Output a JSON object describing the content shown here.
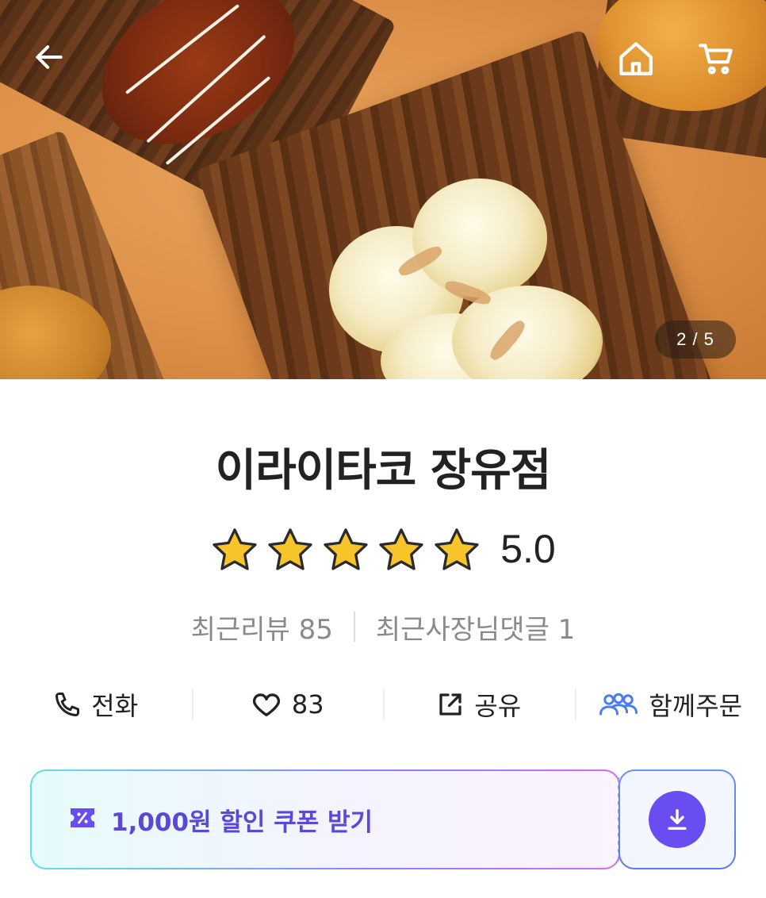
{
  "hero": {
    "image_counter": "2 / 5",
    "icons": {
      "back": "arrow-left-icon",
      "home": "home-icon",
      "cart": "cart-icon"
    }
  },
  "store": {
    "name": "이라이타코 장유점",
    "rating": "5.0",
    "rating_value": 5,
    "rating_max": 5
  },
  "meta": {
    "recent_reviews": "최근리뷰 85",
    "owner_replies": "최근사장님댓글 1"
  },
  "actions": {
    "call": "전화",
    "like_count": "83",
    "share": "공유",
    "group_order": "함께주문"
  },
  "coupon": {
    "label": "1,000원 할인 쿠폰 받기"
  },
  "colors": {
    "accent": "#6a4df0",
    "coupon_text": "#5b48d6",
    "group_icon": "#4a7cf0",
    "star": "#f7c52b"
  }
}
